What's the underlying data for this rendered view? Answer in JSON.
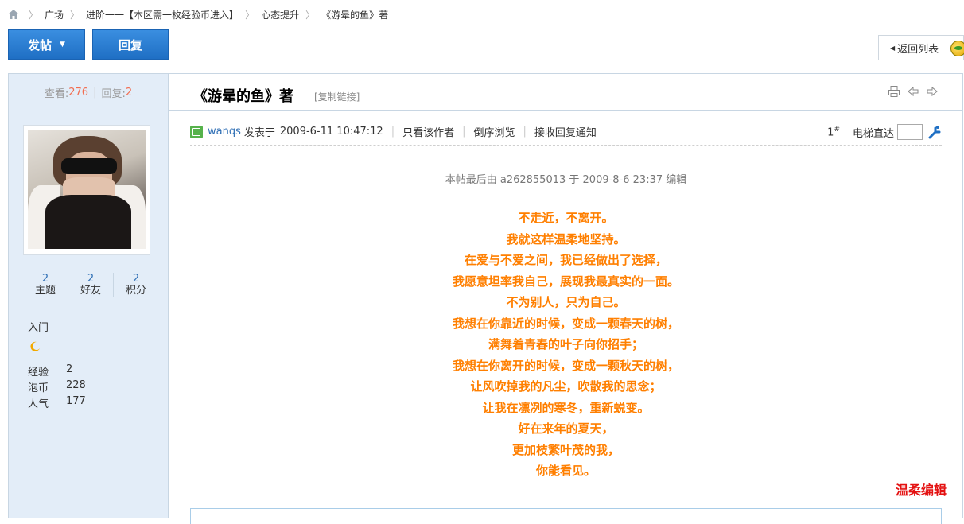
{
  "breadcrumb": {
    "items": [
      "广场",
      "进阶一一【本区需一枚经验币进入】",
      "心态提升",
      "《游晕的鱼》著"
    ]
  },
  "toolbar": {
    "post_label": "发帖",
    "reply_label": "回复",
    "back_label": "返回列表"
  },
  "sidebar": {
    "stats": {
      "views_label": "查看:",
      "views": "276",
      "replies_label": "回复:",
      "replies": "2"
    },
    "counts": [
      {
        "value": "2",
        "label": "主题"
      },
      {
        "value": "2",
        "label": "好友"
      },
      {
        "value": "2",
        "label": "积分"
      }
    ],
    "rank": "入门",
    "info": [
      {
        "key": "经验",
        "value": "2"
      },
      {
        "key": "泡币",
        "value": "228"
      },
      {
        "key": "人气",
        "value": "177"
      }
    ]
  },
  "thread": {
    "title": "《游晕的鱼》著",
    "copy_link": "[复制链接]"
  },
  "post": {
    "author": "wanqs",
    "posted_at_label": "发表于",
    "posted_at": "2009-6-11 10:47:12",
    "only_author": "只看该作者",
    "reverse": "倒序浏览",
    "notify": "接收回复通知",
    "floor": "1",
    "floor_mark": "#",
    "elevator_label": "电梯直达",
    "edit_note": "本帖最后由 a262855013 于 2009-8-6 23:37 编辑",
    "poem": [
      "不走近，不离开。",
      "我就这样温柔地坚持。",
      "  在爱与不爱之间，我已经做出了选择，",
      "我愿意坦率我自己，展现我最真实的一面。",
      "不为别人，只为自己。",
      "我想在你靠近的时候，变成一颗春天的树，",
      "满舞着青春的叶子向你招手；",
      "我想在你离开的时候，变成一颗秋天的树，",
      "让风吹掉我的凡尘，吹散我的思念；",
      "让我在凛冽的寒冬，重新蜕变。",
      "好在来年的夏天，",
      "更加枝繁叶茂的我，",
      "你能看见。"
    ],
    "signature": "温柔编辑"
  },
  "colors": {
    "accent_blue": "#2e7fd1",
    "poem_orange": "#ff7f00",
    "signature_red": "#e41111",
    "sidebar_bg": "#e3edf8"
  }
}
